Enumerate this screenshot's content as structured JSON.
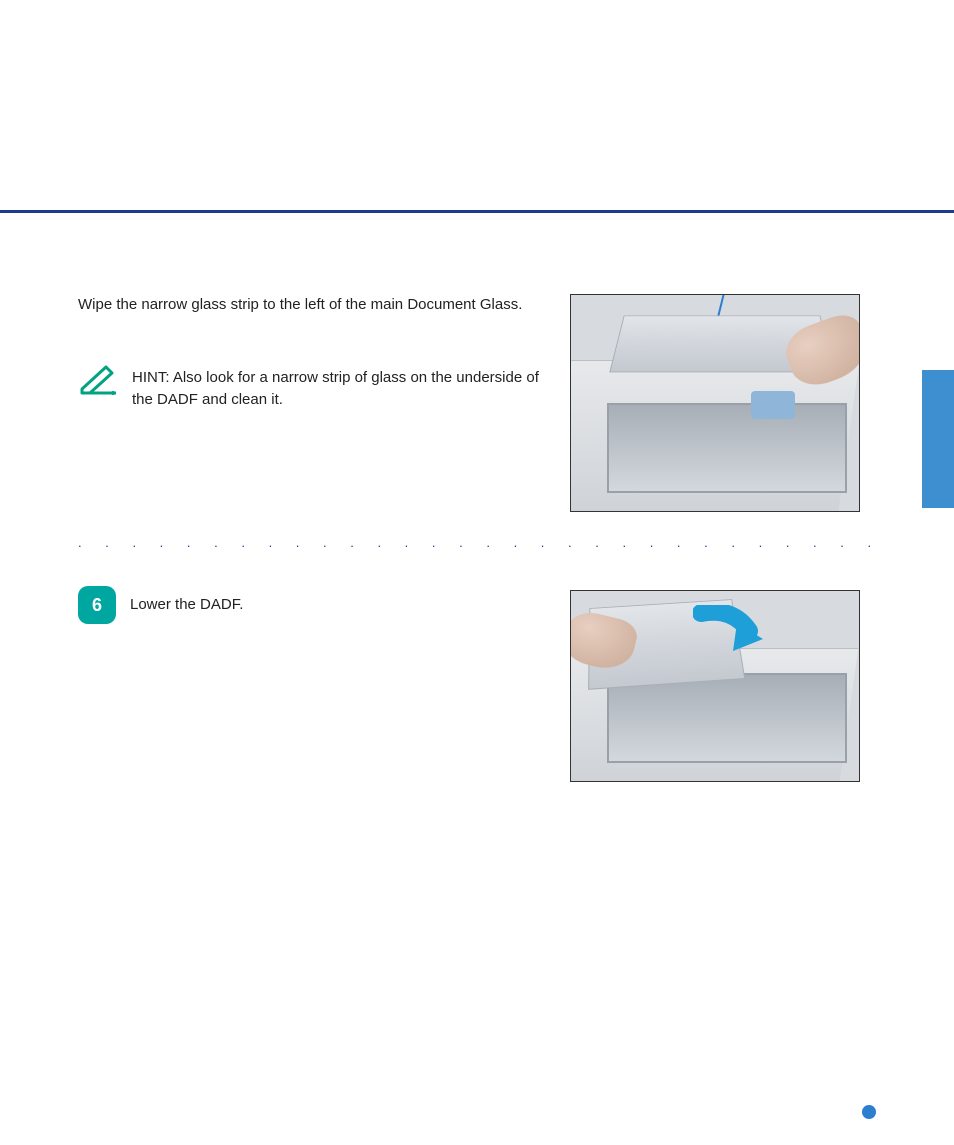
{
  "header": {
    "rule_color": "#1b3d8c"
  },
  "sideTab": {
    "color": "#3d8fcf"
  },
  "step5": {
    "text": "Wipe the narrow glass strip to the left of the main Document Glass.",
    "hint": "HINT: Also look for a narrow strip of glass on the underside of the DADF and clean it."
  },
  "step6": {
    "number": "6",
    "text": "Lower the DADF."
  },
  "separator": ". . . . . . . . . . . . . . . . . . . . . . . . . . . . . . . . . . . . . . . . . . . . . . . . . . . . . . . . . . . . .",
  "icons": {
    "hint": "pencil-hint-icon",
    "arrow": "curved-arrow-icon"
  },
  "colors": {
    "accent_teal": "#00a6a0",
    "accent_blue": "#2c7ecf",
    "rule_blue": "#1b3d8c",
    "tab_blue": "#3d8fcf"
  }
}
